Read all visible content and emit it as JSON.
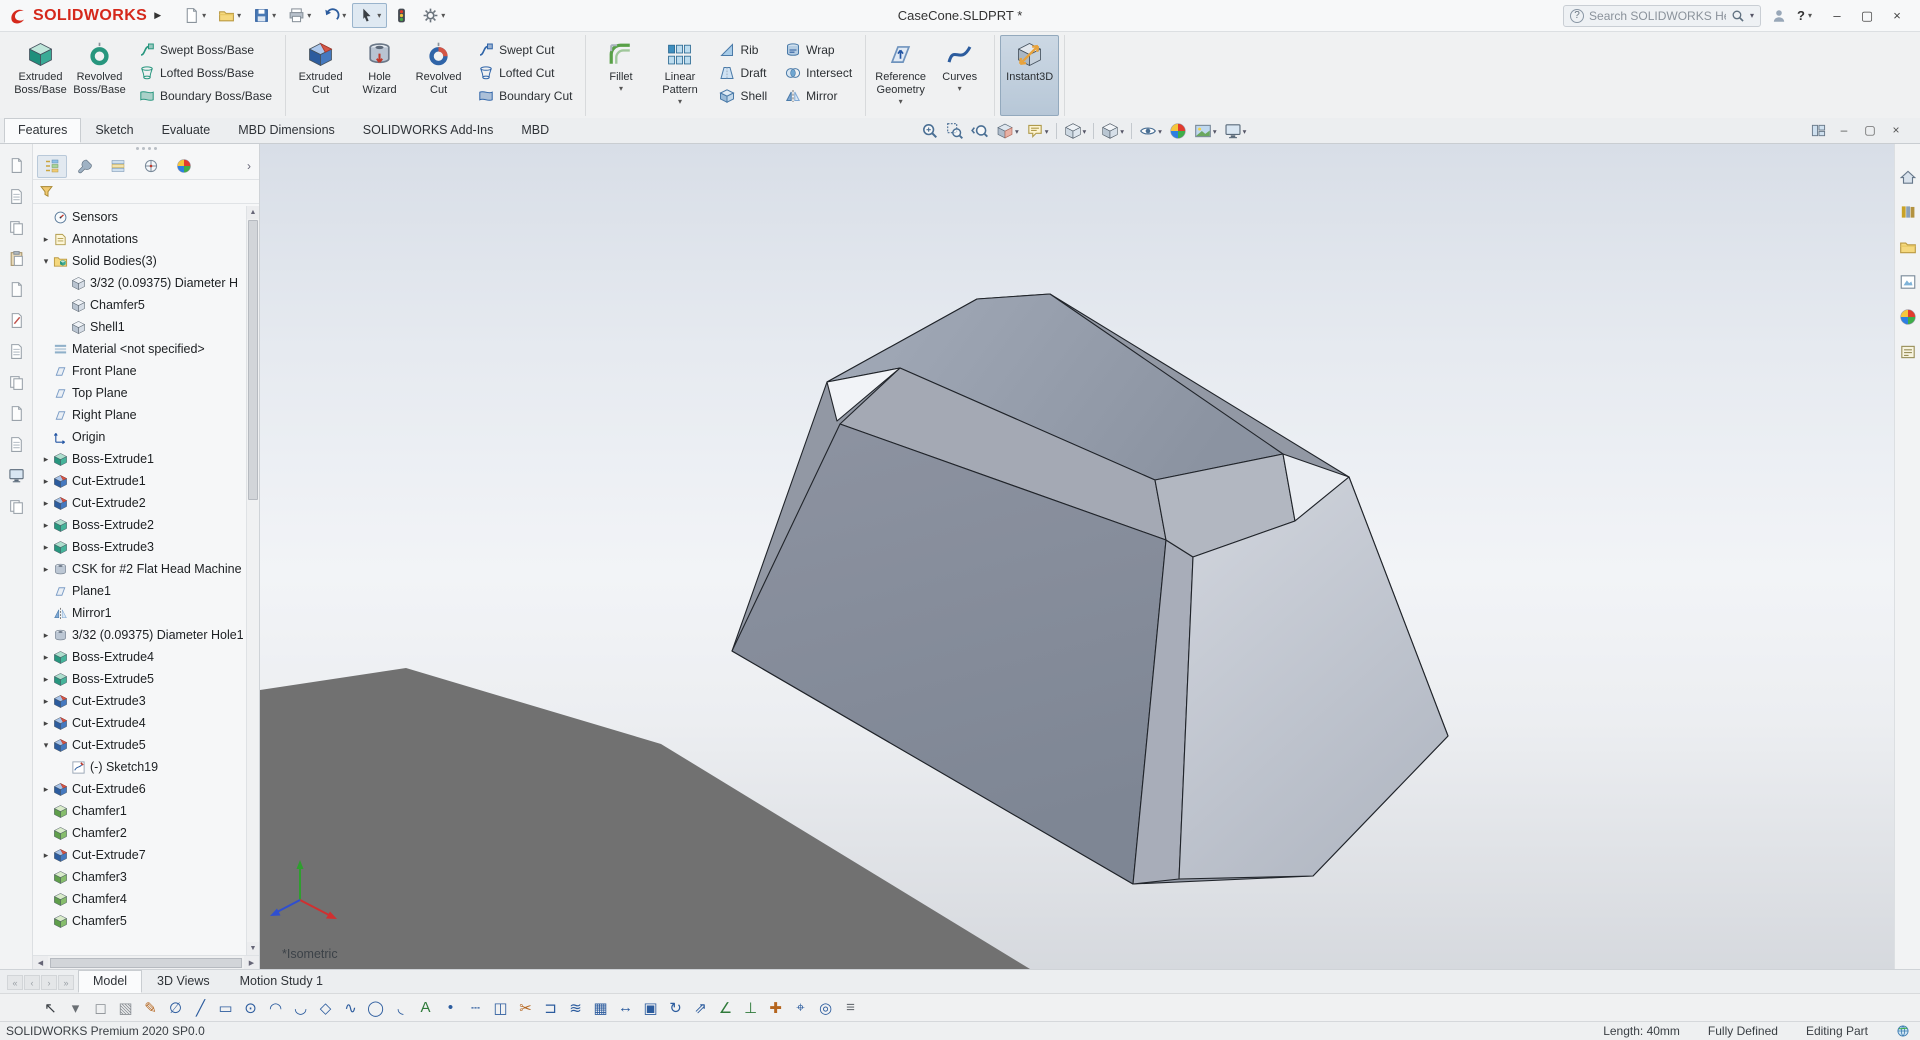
{
  "window": {
    "doc_title": "CaseCone.SLDPRT *"
  },
  "titlebar": {
    "logo_text": "SOLIDWORKS",
    "flyout_arrow": "▶",
    "buttons": [
      {
        "name": "new",
        "icon": "new-doc",
        "dropdown": true
      },
      {
        "name": "open",
        "icon": "open-folder",
        "dropdown": true
      },
      {
        "name": "save",
        "icon": "save",
        "dropdown": true
      },
      {
        "name": "print",
        "icon": "print",
        "dropdown": true
      },
      {
        "name": "undo",
        "icon": "undo",
        "dropdown": true
      },
      {
        "name": "select",
        "icon": "cursor",
        "dropdown": true,
        "pressed": true
      },
      {
        "name": "rebuild",
        "icon": "rebuild",
        "dropdown": false
      },
      {
        "name": "options",
        "icon": "gear",
        "dropdown": true
      }
    ],
    "search_placeholder": "Search SOLIDWORKS Help",
    "help_label": "?",
    "window_controls": [
      {
        "name": "minimize",
        "glyph": "–"
      },
      {
        "name": "maximize",
        "glyph": "▢"
      },
      {
        "name": "close",
        "glyph": "×"
      }
    ]
  },
  "ribbon": {
    "tabs": [
      {
        "label": "Features",
        "active": true
      },
      {
        "label": "Sketch"
      },
      {
        "label": "Evaluate"
      },
      {
        "label": "MBD Dimensions"
      },
      {
        "label": "SOLIDWORKS Add-Ins"
      },
      {
        "label": "MBD"
      }
    ],
    "groups": [
      {
        "name": "boss-group",
        "big": [
          {
            "label": "Extruded Boss/Base",
            "icon": "extruded-boss"
          },
          {
            "label": "Revolved Boss/Base",
            "icon": "revolved-boss"
          }
        ],
        "cols": [
          [
            {
              "label": "Swept Boss/Base",
              "icon": "swept-boss"
            },
            {
              "label": "Lofted Boss/Base",
              "icon": "lofted-boss"
            },
            {
              "label": "Boundary Boss/Base",
              "icon": "boundary-boss"
            }
          ]
        ]
      },
      {
        "name": "cut-group",
        "big": [
          {
            "label": "Extruded Cut",
            "icon": "extruded-cut"
          },
          {
            "label": "Hole Wizard",
            "icon": "hole-wizard"
          },
          {
            "label": "Revolved Cut",
            "icon": "revolved-cut"
          }
        ],
        "cols": [
          [
            {
              "label": "Swept Cut",
              "icon": "swept-cut"
            },
            {
              "label": "Lofted Cut",
              "icon": "lofted-cut"
            },
            {
              "label": "Boundary Cut",
              "icon": "boundary-cut"
            }
          ]
        ]
      },
      {
        "name": "pattern-group",
        "big": [
          {
            "label": "Fillet",
            "icon": "fillet",
            "dropdown": true
          },
          {
            "label": "Linear Pattern",
            "icon": "linear-pattern",
            "dropdown": true
          }
        ],
        "cols": [
          [
            {
              "label": "Rib",
              "icon": "rib"
            },
            {
              "label": "Draft",
              "icon": "draft"
            },
            {
              "label": "Shell",
              "icon": "shell"
            }
          ],
          [
            {
              "label": "Wrap",
              "icon": "wrap"
            },
            {
              "label": "Intersect",
              "icon": "intersect"
            },
            {
              "label": "Mirror",
              "icon": "mirror"
            }
          ]
        ]
      },
      {
        "name": "reference-group",
        "big": [
          {
            "label": "Reference Geometry",
            "icon": "ref-geometry",
            "dropdown": true
          },
          {
            "label": "Curves",
            "icon": "curves",
            "dropdown": true
          }
        ]
      },
      {
        "name": "instant3d-group",
        "big": [
          {
            "label": "Instant3D",
            "icon": "instant3d",
            "active": true
          }
        ]
      }
    ]
  },
  "headsup": [
    {
      "name": "zoom-fit",
      "icon": "zoom-fit"
    },
    {
      "name": "zoom-area",
      "icon": "zoom-area"
    },
    {
      "name": "previous-view",
      "icon": "prev-view"
    },
    {
      "name": "section-view",
      "icon": "section",
      "dropdown": true
    },
    {
      "name": "dynamic-annotation-views",
      "icon": "annot",
      "dropdown": true
    },
    {
      "sep": true
    },
    {
      "name": "view-orientation",
      "icon": "viewcube",
      "dropdown": true
    },
    {
      "sep": true
    },
    {
      "name": "display-style",
      "icon": "display-style",
      "dropdown": true
    },
    {
      "sep": true
    },
    {
      "name": "hide-show-items",
      "icon": "eye",
      "dropdown": true
    },
    {
      "name": "edit-appearance",
      "icon": "beachball"
    },
    {
      "name": "apply-scene",
      "icon": "scene",
      "dropdown": true
    },
    {
      "name": "view-settings",
      "icon": "monitor",
      "dropdown": true
    }
  ],
  "doc_controls": [
    {
      "name": "viewport-layout",
      "icon": "panes"
    },
    {
      "name": "doc-minimize",
      "glyph": "–"
    },
    {
      "name": "doc-restore",
      "glyph": "▢"
    },
    {
      "name": "doc-close",
      "glyph": "×"
    }
  ],
  "left_toolbar": [
    {
      "name": "left-tool-1",
      "icon": "doc"
    },
    {
      "name": "left-tool-2",
      "icon": "doc-grid"
    },
    {
      "name": "left-tool-3",
      "icon": "copy"
    },
    {
      "name": "left-tool-4",
      "icon": "paste"
    },
    {
      "name": "left-tool-5",
      "icon": "doc"
    },
    {
      "name": "left-tool-6",
      "icon": "doc-pencil"
    },
    {
      "name": "left-tool-7",
      "icon": "doc-grid"
    },
    {
      "name": "left-tool-8",
      "icon": "copy"
    },
    {
      "name": "left-tool-9",
      "icon": "doc"
    },
    {
      "name": "left-tool-10",
      "icon": "doc-grid"
    },
    {
      "name": "left-tool-11",
      "icon": "monitor"
    },
    {
      "name": "left-tool-12",
      "icon": "copy"
    }
  ],
  "feature_tree": {
    "tabs": [
      {
        "name": "feature-manager",
        "icon": "featmgr",
        "active": true
      },
      {
        "name": "property-manager",
        "icon": "propmgr"
      },
      {
        "name": "configuration-manager",
        "icon": "configmgr"
      },
      {
        "name": "dimxpert-manager",
        "icon": "dimxpert"
      },
      {
        "name": "display-manager",
        "icon": "displaymgr"
      }
    ],
    "more_chevron": "›",
    "items": [
      {
        "label": "Sensors",
        "icon": "sensors",
        "level": 0,
        "arrow": ""
      },
      {
        "label": "Annotations",
        "icon": "annotations",
        "level": 0,
        "arrow": "r"
      },
      {
        "label": "Solid Bodies(3)",
        "icon": "solid-folder",
        "level": 0,
        "arrow": "d"
      },
      {
        "label": "3/32 (0.09375) Diameter H",
        "icon": "body",
        "level": 1,
        "arrow": ""
      },
      {
        "label": "Chamfer5",
        "icon": "body",
        "level": 1,
        "arrow": ""
      },
      {
        "label": "Shell1",
        "icon": "body",
        "level": 1,
        "arrow": ""
      },
      {
        "label": "Material <not specified>",
        "icon": "material",
        "level": 0,
        "arrow": ""
      },
      {
        "label": "Front Plane",
        "icon": "plane",
        "level": 0,
        "arrow": ""
      },
      {
        "label": "Top Plane",
        "icon": "plane",
        "level": 0,
        "arrow": ""
      },
      {
        "label": "Right Plane",
        "icon": "plane",
        "level": 0,
        "arrow": ""
      },
      {
        "label": "Origin",
        "icon": "origin",
        "level": 0,
        "arrow": ""
      },
      {
        "label": "Boss-Extrude1",
        "icon": "boss",
        "level": 0,
        "arrow": "r"
      },
      {
        "label": "Cut-Extrude1",
        "icon": "cut",
        "level": 0,
        "arrow": "r"
      },
      {
        "label": "Cut-Extrude2",
        "icon": "cut",
        "level": 0,
        "arrow": "r"
      },
      {
        "label": "Boss-Extrude2",
        "icon": "boss",
        "level": 0,
        "arrow": "r"
      },
      {
        "label": "Boss-Extrude3",
        "icon": "boss",
        "level": 0,
        "arrow": "r"
      },
      {
        "label": "CSK for #2 Flat Head Machine",
        "icon": "hole",
        "level": 0,
        "arrow": "r"
      },
      {
        "label": "Plane1",
        "icon": "plane",
        "level": 0,
        "arrow": ""
      },
      {
        "label": "Mirror1",
        "icon": "mirror-f",
        "level": 0,
        "arrow": ""
      },
      {
        "label": "3/32 (0.09375) Diameter Hole1",
        "icon": "hole",
        "level": 0,
        "arrow": "r"
      },
      {
        "label": "Boss-Extrude4",
        "icon": "boss",
        "level": 0,
        "arrow": "r"
      },
      {
        "label": "Boss-Extrude5",
        "icon": "boss",
        "level": 0,
        "arrow": "r"
      },
      {
        "label": "Cut-Extrude3",
        "icon": "cut",
        "level": 0,
        "arrow": "r"
      },
      {
        "label": "Cut-Extrude4",
        "icon": "cut",
        "level": 0,
        "arrow": "r"
      },
      {
        "label": "Cut-Extrude5",
        "icon": "cut",
        "level": 0,
        "arrow": "d"
      },
      {
        "label": "(-) Sketch19",
        "icon": "sketch",
        "level": 1,
        "arrow": ""
      },
      {
        "label": "Cut-Extrude6",
        "icon": "cut",
        "level": 0,
        "arrow": "r"
      },
      {
        "label": "Chamfer1",
        "icon": "chamfer",
        "level": 0,
        "arrow": ""
      },
      {
        "label": "Chamfer2",
        "icon": "chamfer",
        "level": 0,
        "arrow": ""
      },
      {
        "label": "Cut-Extrude7",
        "icon": "cut",
        "level": 0,
        "arrow": "r"
      },
      {
        "label": "Chamfer3",
        "icon": "chamfer",
        "level": 0,
        "arrow": ""
      },
      {
        "label": "Chamfer4",
        "icon": "chamfer",
        "level": 0,
        "arrow": ""
      },
      {
        "label": "Chamfer5",
        "icon": "chamfer",
        "level": 0,
        "arrow": ""
      }
    ]
  },
  "viewport": {
    "view_label": "*Isometric"
  },
  "task_pane": [
    {
      "name": "solidworks-resources",
      "icon": "home"
    },
    {
      "name": "design-library",
      "icon": "books"
    },
    {
      "name": "file-explorer",
      "icon": "open-folder"
    },
    {
      "name": "view-palette",
      "icon": "view-palette"
    },
    {
      "name": "appearances-scenes",
      "icon": "beachball"
    },
    {
      "name": "custom-properties",
      "icon": "props"
    }
  ],
  "bottom": {
    "nav": [
      "«",
      "‹",
      "›",
      "»"
    ],
    "tabs": [
      {
        "label": "Model",
        "active": true
      },
      {
        "label": "3D Views"
      },
      {
        "label": "Motion Study 1"
      }
    ]
  },
  "sketch_toolbar": [
    {
      "name": "select-tool",
      "glyph": "↖",
      "color": "#3a3f44"
    },
    {
      "name": "select-dropdown",
      "glyph": "▾",
      "color": "#6a6f74"
    },
    {
      "name": "lasso-select",
      "glyph": "◻",
      "color": "#8a8f94"
    },
    {
      "name": "box-select",
      "glyph": "▧",
      "color": "#8a8f94"
    },
    {
      "name": "sketch",
      "glyph": "✎",
      "color": "#b5651d"
    },
    {
      "name": "smart-dimension",
      "glyph": "∅",
      "color": "#2c5c9e"
    },
    {
      "name": "line",
      "glyph": "╱",
      "color": "#2c5c9e"
    },
    {
      "name": "rectangle",
      "glyph": "▭",
      "color": "#2c5c9e"
    },
    {
      "name": "circle",
      "glyph": "⊙",
      "color": "#2c5c9e"
    },
    {
      "name": "arc",
      "glyph": "◠",
      "color": "#2c5c9e"
    },
    {
      "name": "three-point-arc",
      "glyph": "◡",
      "color": "#2c5c9e"
    },
    {
      "name": "polygon",
      "glyph": "◇",
      "color": "#2c5c9e"
    },
    {
      "name": "spline",
      "glyph": "∿",
      "color": "#2c5c9e"
    },
    {
      "name": "ellipse",
      "glyph": "◯",
      "color": "#2c5c9e"
    },
    {
      "name": "sketch-fillet",
      "glyph": "◟",
      "color": "#2c5c9e"
    },
    {
      "name": "text",
      "glyph": "A",
      "color": "#2f7a3a"
    },
    {
      "name": "point",
      "glyph": "•",
      "color": "#2c5c9e"
    },
    {
      "name": "centerline",
      "glyph": "┄",
      "color": "#2c5c9e"
    },
    {
      "name": "mirror-entities",
      "glyph": "◫",
      "color": "#2c5c9e"
    },
    {
      "name": "trim-entities",
      "glyph": "✂",
      "color": "#b5651d"
    },
    {
      "name": "convert-entities",
      "glyph": "⊐",
      "color": "#2c5c9e"
    },
    {
      "name": "offset-entities",
      "glyph": "≋",
      "color": "#2c5c9e"
    },
    {
      "name": "linear-sketch-pattern",
      "glyph": "▦",
      "color": "#2c5c9e"
    },
    {
      "name": "move-entities",
      "glyph": "↔",
      "color": "#2c5c9e"
    },
    {
      "name": "copy-entities",
      "glyph": "▣",
      "color": "#2c5c9e"
    },
    {
      "name": "rotate-entities",
      "glyph": "↻",
      "color": "#2c5c9e"
    },
    {
      "name": "scale-entities",
      "glyph": "⇗",
      "color": "#2c5c9e"
    },
    {
      "name": "display-relations",
      "glyph": "∠",
      "color": "#2f7a3a"
    },
    {
      "name": "add-relation",
      "glyph": "⊥",
      "color": "#2f7a3a"
    },
    {
      "name": "repair-sketch",
      "glyph": "✚",
      "color": "#b5651d"
    },
    {
      "name": "quick-snaps",
      "glyph": "⌖",
      "color": "#2c5c9e"
    },
    {
      "name": "rapid-sketch",
      "glyph": "◎",
      "color": "#2c5c9e"
    },
    {
      "name": "sketch-settings",
      "glyph": "≡",
      "color": "#6a6f74"
    }
  ],
  "statusbar": {
    "left": "SOLIDWORKS Premium 2020 SP0.0",
    "items": [
      "Length: 40mm",
      "Fully Defined",
      "Editing Part"
    ]
  },
  "colors": {
    "logo_red": "#d5281b",
    "boss_teal": "#27967e",
    "cut_blue": "#2f64a8",
    "active_button_bg": "#bac9d8"
  }
}
